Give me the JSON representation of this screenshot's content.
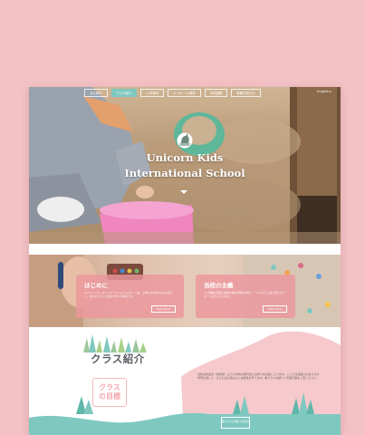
{
  "nav": {
    "items": [
      "当社案内",
      "クラス紹介",
      "入学案内",
      "メッセージ/理念",
      "学校建築",
      "各種お知らせ"
    ],
    "active_index": 1,
    "lang": "English ▸"
  },
  "hero": {
    "title_line1": "Unicorn Kids",
    "title_line2": "International School",
    "logo_icon": "unicorn-icon",
    "scroll_icon": "chevron-down-icon"
  },
  "cards": [
    {
      "title": "はじめに",
      "text": "ユニコーンキッズインターナショナルスクールは、子供たちの好奇心を大切にし、のびのびとした環境で学べる学校です。",
      "button": "Read More"
    },
    {
      "title": "当校の主義",
      "text": "少人数制の授業と個性を伸ばす教育方針で、一人ひとりに寄り添ったサポートを行っています。",
      "button": "Read More"
    }
  ],
  "class_section": {
    "title": "クラス紹介",
    "goal_label_1": "クラス",
    "goal_label_2": "の目標",
    "description": "当校は乳幼児（未就学）より小学校の教育的土台作りを目指しています。ここでは英語でのあそびや学習を通して、子ども達の自立心と協調性を育てます。各クラスの紹介と年間行事をご覧ください。",
    "button": "各クラスの紹介を見る"
  },
  "colors": {
    "background": "#f2c2c5",
    "accent_teal": "#7fc8c0",
    "card_pink": "#ec969c",
    "title_gray": "#5b5f66"
  }
}
